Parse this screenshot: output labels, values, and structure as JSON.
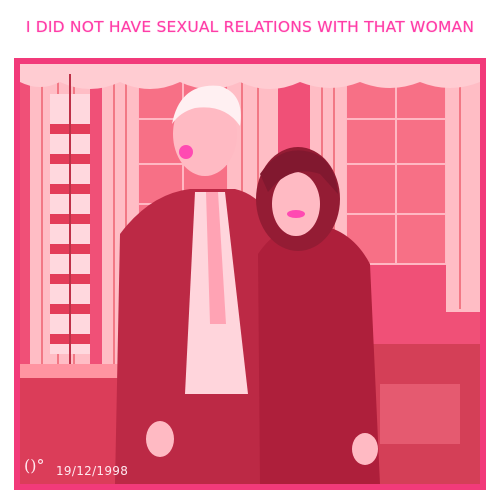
{
  "caption": "I DID NOT HAVE SEXUAL RELATIONS WITH THAT WOMAN",
  "date_stamp": "19/12/1998",
  "stamp_logo": "()°",
  "colors": {
    "caption_pink": "#ff3ca6",
    "photo_red": "#f03c6e",
    "frame_pink": "#f23a7a",
    "highlight": "#ffd0d8"
  }
}
